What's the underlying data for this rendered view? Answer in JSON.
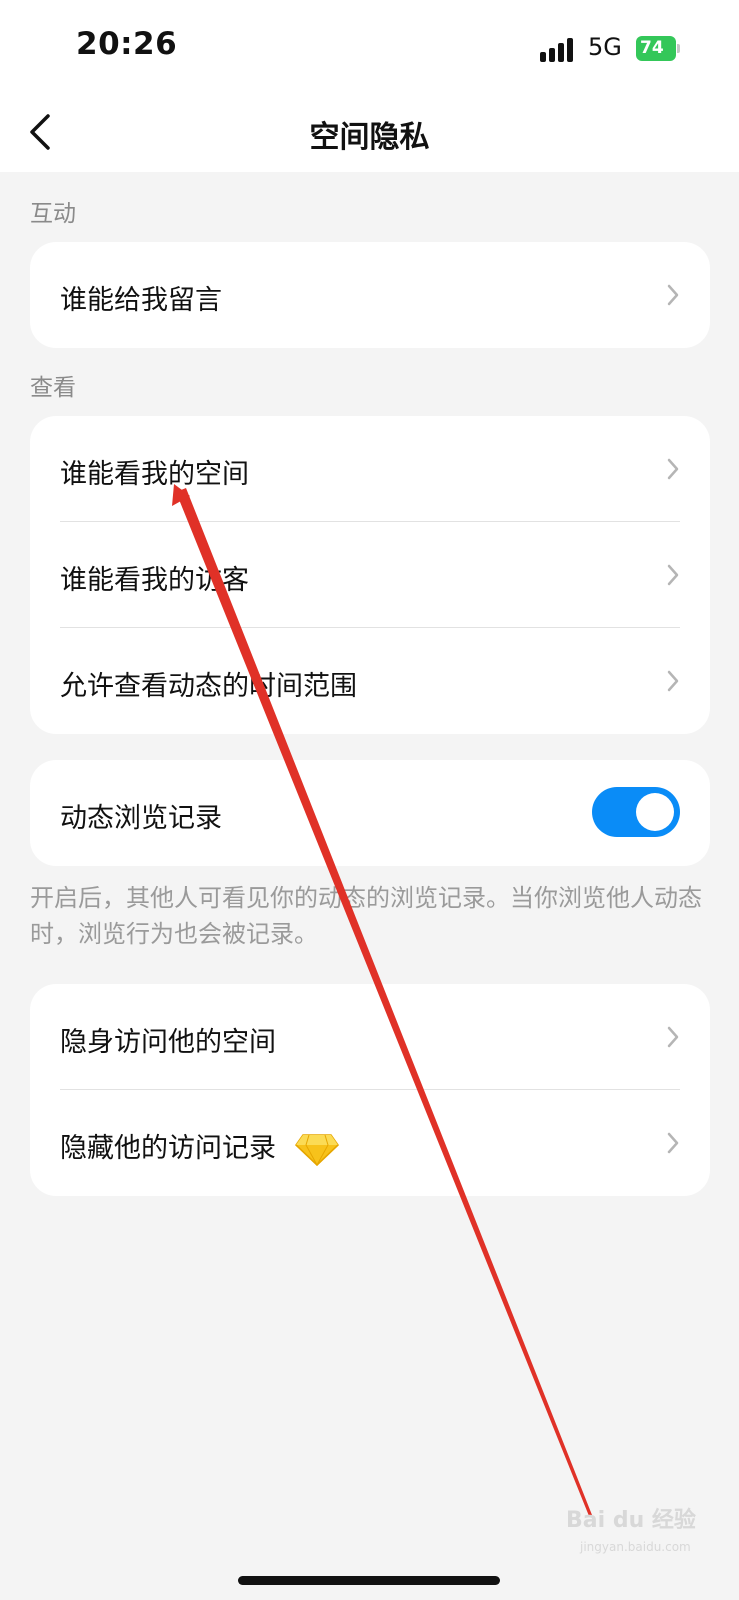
{
  "status": {
    "time": "20:26",
    "network": "5G",
    "battery": "74"
  },
  "header": {
    "title": "空间隐私"
  },
  "sections": {
    "interaction": {
      "label": "互动",
      "items": [
        "谁能给我留言"
      ]
    },
    "view": {
      "label": "查看",
      "items": [
        "谁能看我的空间",
        "谁能看我的访客",
        "允许查看动态的时间范围"
      ]
    },
    "browse": {
      "label": "动态浏览记录",
      "toggle_on": true
    },
    "browse_desc": "开启后，其他人可看见你的动态的浏览记录。当你浏览他人动态时，浏览行为也会被记录。",
    "stealth": {
      "items": [
        "隐身访问他的空间",
        "隐藏他的访问记录"
      ]
    }
  },
  "watermark": {
    "brand": "Bai du 经验",
    "url": "jingyan.baidu.com"
  },
  "colors": {
    "toggle": "#0a8cf7",
    "annotation": "#e03127",
    "battery": "#34c759"
  }
}
